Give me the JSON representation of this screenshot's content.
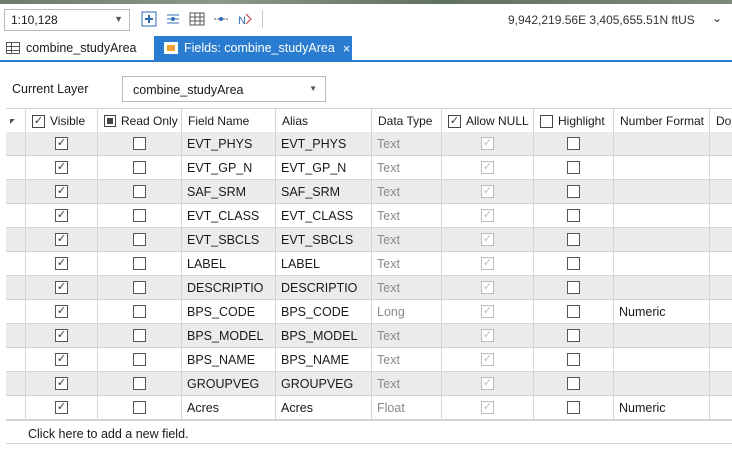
{
  "toolbar": {
    "scale_value": "1:10,128",
    "coordinates": "9,942,219.56E 3,405,655.51N ftUS",
    "coords_dropdown_glyph": "⌄"
  },
  "tabs": [
    {
      "label": "combine_studyArea",
      "icon": "table-icon",
      "active": false
    },
    {
      "label": "Fields:  combine_studyArea",
      "icon": "fields-icon",
      "active": true,
      "close": "×"
    }
  ],
  "layer": {
    "label": "Current Layer",
    "value": "combine_studyArea"
  },
  "table": {
    "columns": [
      "Visible",
      "Read Only",
      "Field Name",
      "Alias",
      "Data Type",
      "Allow NULL",
      "Highlight",
      "Number Format",
      "Do"
    ],
    "rows": [
      {
        "visible": true,
        "read_only": false,
        "field_name": "EVT_PHYS",
        "alias": "EVT_PHYS",
        "data_type": "Text",
        "allow_null": true,
        "highlight": false,
        "number_format": ""
      },
      {
        "visible": true,
        "read_only": false,
        "field_name": "EVT_GP_N",
        "alias": "EVT_GP_N",
        "data_type": "Text",
        "allow_null": true,
        "highlight": false,
        "number_format": ""
      },
      {
        "visible": true,
        "read_only": false,
        "field_name": "SAF_SRM",
        "alias": "SAF_SRM",
        "data_type": "Text",
        "allow_null": true,
        "highlight": false,
        "number_format": ""
      },
      {
        "visible": true,
        "read_only": false,
        "field_name": "EVT_CLASS",
        "alias": "EVT_CLASS",
        "data_type": "Text",
        "allow_null": true,
        "highlight": false,
        "number_format": ""
      },
      {
        "visible": true,
        "read_only": false,
        "field_name": "EVT_SBCLS",
        "alias": "EVT_SBCLS",
        "data_type": "Text",
        "allow_null": true,
        "highlight": false,
        "number_format": ""
      },
      {
        "visible": true,
        "read_only": false,
        "field_name": "LABEL",
        "alias": "LABEL",
        "data_type": "Text",
        "allow_null": true,
        "highlight": false,
        "number_format": ""
      },
      {
        "visible": true,
        "read_only": false,
        "field_name": "DESCRIPTIO",
        "alias": "DESCRIPTIO",
        "data_type": "Text",
        "allow_null": true,
        "highlight": false,
        "number_format": ""
      },
      {
        "visible": true,
        "read_only": false,
        "field_name": "BPS_CODE",
        "alias": "BPS_CODE",
        "data_type": "Long",
        "allow_null": true,
        "highlight": false,
        "number_format": "Numeric"
      },
      {
        "visible": true,
        "read_only": false,
        "field_name": "BPS_MODEL",
        "alias": "BPS_MODEL",
        "data_type": "Text",
        "allow_null": true,
        "highlight": false,
        "number_format": ""
      },
      {
        "visible": true,
        "read_only": false,
        "field_name": "BPS_NAME",
        "alias": "BPS_NAME",
        "data_type": "Text",
        "allow_null": true,
        "highlight": false,
        "number_format": ""
      },
      {
        "visible": true,
        "read_only": false,
        "field_name": "GROUPVEG",
        "alias": "GROUPVEG",
        "data_type": "Text",
        "allow_null": true,
        "highlight": false,
        "number_format": ""
      },
      {
        "visible": true,
        "read_only": false,
        "field_name": "Acres",
        "alias": "Acres",
        "data_type": "Float",
        "allow_null": true,
        "highlight": false,
        "number_format": "Numeric"
      }
    ],
    "add_row_text": "Click here to add a new field."
  },
  "colors": {
    "accent": "#2a7cd0",
    "row_alt": "#ebebeb",
    "disabled_text": "#8a8a8a"
  },
  "glyphs": {
    "check": "✓"
  }
}
